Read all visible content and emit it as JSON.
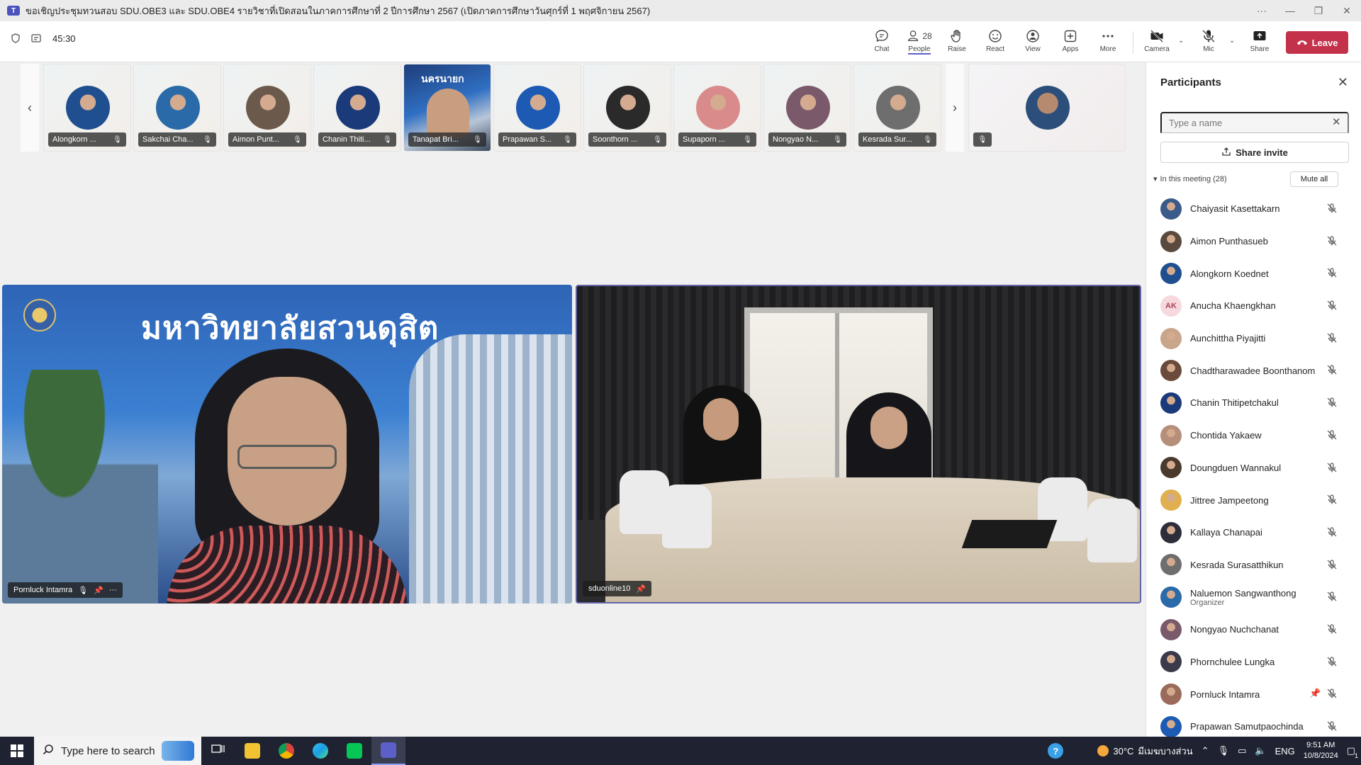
{
  "window": {
    "title": "ขอเชิญประชุมทวนสอบ SDU.OBE3 และ SDU.OBE4 รายวิชาที่เปิดสอนในภาคการศึกษาที่ 2 ปีการศึกษา 2567 (เปิดภาคการศึกษาวันศุกร์ที่ 1 พฤศจิกายน 2567)",
    "more": "···",
    "minimize": "—",
    "maximize": "❐",
    "close": "✕"
  },
  "toolbar": {
    "timer": "45:30",
    "chat": "Chat",
    "people": "People",
    "people_count": "28",
    "raise": "Raise",
    "react": "React",
    "view": "View",
    "apps": "Apps",
    "more": "More",
    "camera": "Camera",
    "mic": "Mic",
    "share": "Share",
    "leave": "Leave"
  },
  "strip": {
    "prev": "‹",
    "next": "›",
    "thumbnails": [
      {
        "name": "Alongkorn ...",
        "color": "#1f4f8f"
      },
      {
        "name": "Sakchai Cha...",
        "color": "#2b6aa8"
      },
      {
        "name": "Aimon Punt...",
        "color": "#6b5a4c"
      },
      {
        "name": "Chanin Thiti...",
        "color": "#1a3a7a"
      },
      {
        "name": "Tanapat Bri...",
        "banner": "นครนายก"
      },
      {
        "name": "Prapawan S...",
        "color": "#1c5ab3"
      },
      {
        "name": "Soonthorn ...",
        "color": "#2a2a2a"
      },
      {
        "name": "Supaporn ...",
        "color": "#d98a8a"
      },
      {
        "name": "Nongyao N...",
        "color": "#7a5a6a"
      },
      {
        "name": "Kesrada Sur...",
        "color": "#6e6e6e"
      }
    ]
  },
  "main": {
    "left_name": "Pornluck Intamra",
    "left_banner": "มหาวิทยาลัยสวนดุสิต",
    "right_name": "sduonline10"
  },
  "panel": {
    "title": "Participants",
    "search_placeholder": "Type a name",
    "share_invite": "Share invite",
    "in_meeting": "In this meeting (28)",
    "mute_all": "Mute all",
    "participants": [
      {
        "name": "Chaiyasit Kasettakarn",
        "role": "",
        "color": "#3a5a8a"
      },
      {
        "name": "Aimon Punthasueb",
        "role": "",
        "color": "#5a4a3e"
      },
      {
        "name": "Alongkorn Koednet",
        "role": "",
        "color": "#1f4f8f"
      },
      {
        "name": "Anucha Khaengkhan",
        "role": "",
        "initials": "AK",
        "color": "#f6d9de"
      },
      {
        "name": "Aunchittha Piyajitti",
        "role": "",
        "color": "#c9a58a"
      },
      {
        "name": "Chadtharawadee Boonthanom",
        "role": "",
        "color": "#6a4a3a"
      },
      {
        "name": "Chanin Thitipetchakul",
        "role": "",
        "color": "#1a3a7a"
      },
      {
        "name": "Chontida Yakaew",
        "role": "",
        "color": "#b58f7a"
      },
      {
        "name": "Doungduen Wannakul",
        "role": "",
        "color": "#4a3a2e"
      },
      {
        "name": "Jittree Jampeetong",
        "role": "",
        "color": "#e0b050"
      },
      {
        "name": "Kallaya Chanapai",
        "role": "",
        "color": "#2e2e3a"
      },
      {
        "name": "Kesrada Surasatthikun",
        "role": "",
        "color": "#6e6e6e"
      },
      {
        "name": "Naluemon Sangwanthong",
        "role": "Organizer",
        "color": "#2b6aa8"
      },
      {
        "name": "Nongyao Nuchchanat",
        "role": "",
        "color": "#7a5a6a"
      },
      {
        "name": "Phornchulee Lungka",
        "role": "",
        "color": "#3a3a4a"
      },
      {
        "name": "Pornluck Intamra",
        "role": "",
        "color": "#9a6a5a",
        "pinned": true
      },
      {
        "name": "Prapawan Samutpaochinda",
        "role": "",
        "color": "#1c5ab3"
      }
    ]
  },
  "taskbar": {
    "search_placeholder": "Type here to search",
    "temperature": "30°C",
    "weather_text": "มีเมฆบางส่วน",
    "lang": "ENG",
    "time": "9:51 AM",
    "date": "10/8/2024",
    "notifications": "1"
  },
  "colors": {
    "accent": "#5b5fc7",
    "leave": "#c4314b",
    "taskbar": "#1f2230"
  }
}
